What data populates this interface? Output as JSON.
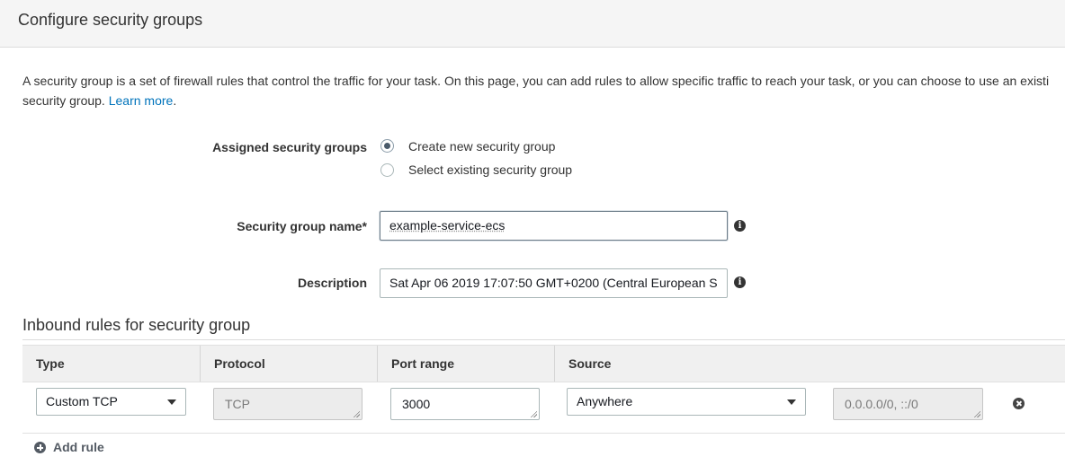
{
  "header": {
    "title": "Configure security groups"
  },
  "intro": {
    "line1": "A security group is a set of firewall rules that control the traffic for your task. On this page, you can add rules to allow specific traffic to reach your task, or you can choose to use an existi",
    "line2_prefix": "security group. ",
    "learn_more": "Learn more",
    "line2_suffix": "."
  },
  "assigned": {
    "label": "Assigned security groups",
    "options": [
      {
        "label": "Create new security group",
        "checked": true
      },
      {
        "label": "Select existing security group",
        "checked": false
      }
    ]
  },
  "group_name": {
    "label": "Security group name*",
    "value": "example-service-ecs"
  },
  "description": {
    "label": "Description",
    "value": "Sat Apr 06 2019 17:07:50 GMT+0200 (Central European S"
  },
  "inbound": {
    "title": "Inbound rules for security group",
    "columns": [
      "Type",
      "Protocol",
      "Port range",
      "Source"
    ],
    "rows": [
      {
        "type": "Custom TCP",
        "protocol": "TCP",
        "port_range": "3000",
        "source": "Anywhere",
        "cidr": "0.0.0.0/0, ::/0"
      }
    ],
    "add_rule": "Add rule"
  },
  "icons": {
    "info": "info-icon",
    "remove": "remove-circle-icon",
    "add": "plus-circle-icon",
    "caret": "caret-down-icon"
  },
  "colors": {
    "link": "#0073bb",
    "header_bg": "#f5f5f5",
    "table_head_bg": "#f0f0f0"
  }
}
